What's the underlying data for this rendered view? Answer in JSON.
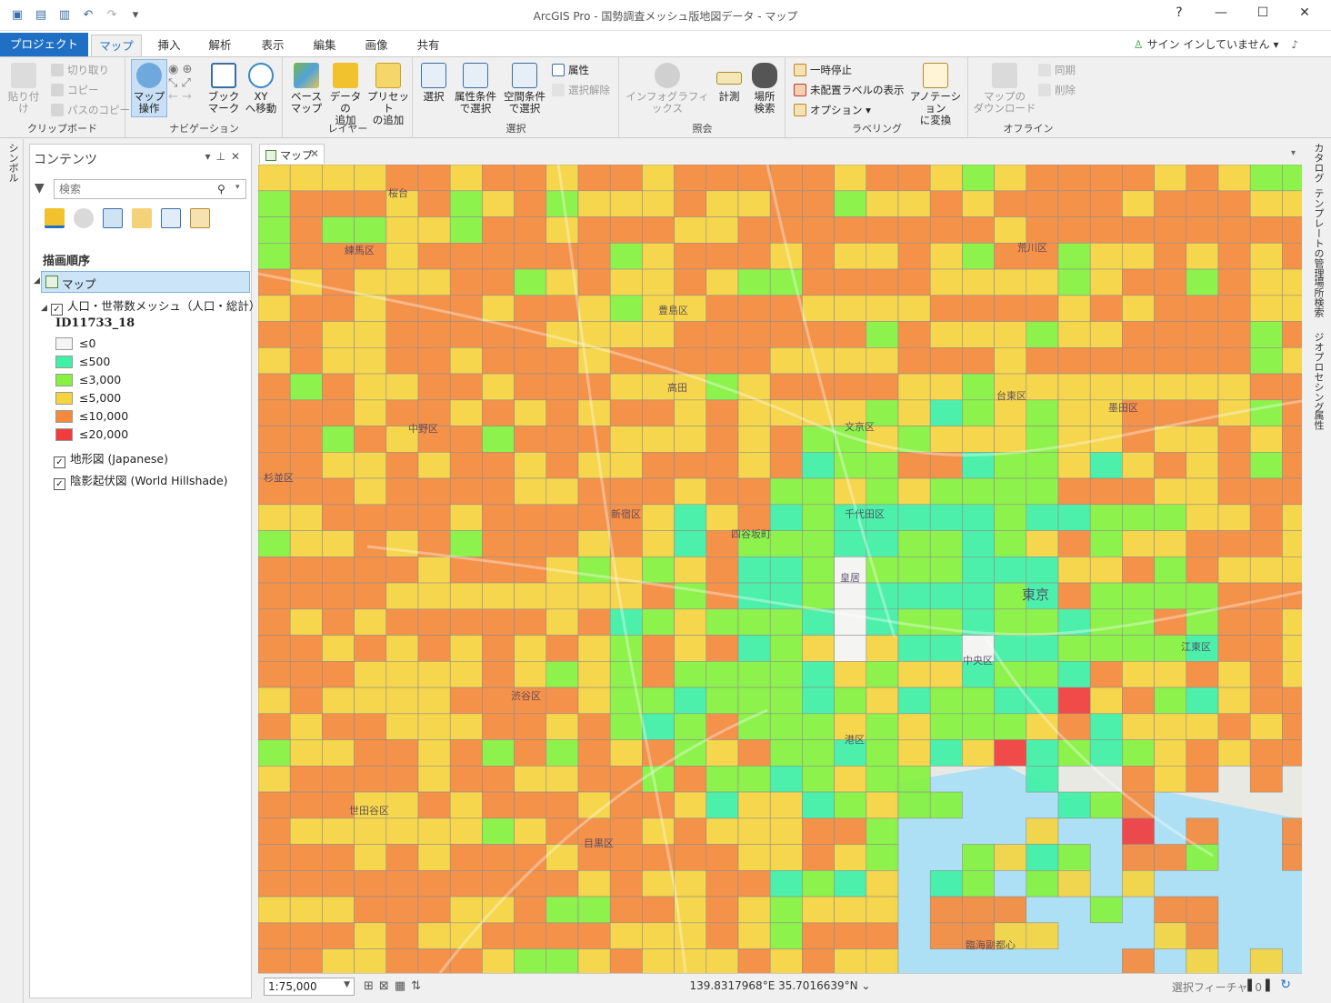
{
  "app": {
    "title": "ArcGIS Pro - 国勢調査メッシュ版地図データ - マップ",
    "help": "?",
    "minimize": "—",
    "maximize": "☐",
    "close": "✕"
  },
  "tabs": [
    {
      "label": "プロジェクト"
    },
    {
      "label": "マップ"
    },
    {
      "label": "挿入"
    },
    {
      "label": "解析"
    },
    {
      "label": "表示"
    },
    {
      "label": "編集"
    },
    {
      "label": "画像"
    },
    {
      "label": "共有"
    }
  ],
  "signin": "サイン インしていません",
  "ribbon": {
    "clipboard": {
      "label": "クリップボード",
      "paste": "貼り付け",
      "cut": "切り取り",
      "copy": "コピー",
      "copy_path": "パスのコピー"
    },
    "navigation": {
      "label": "ナビゲーション",
      "explore_1": "マップ",
      "explore_2": "操作",
      "bookmark_1": "ブック",
      "bookmark_2": "マーク",
      "xy_1": "XY",
      "xy_2": "へ移動"
    },
    "layer": {
      "label": "レイヤー",
      "basemap_1": "ベース",
      "basemap_2": "マップ",
      "adddata_1": "データの",
      "adddata_2": "追加",
      "preset_1": "プリセット",
      "preset_2": "の追加"
    },
    "selection": {
      "label": "選択",
      "select": "選択",
      "attr_1": "属性条件",
      "attr_2": "で選択",
      "loc_1": "空間条件",
      "loc_2": "で選択",
      "attributes": "属性",
      "clear": "選択解除"
    },
    "inquiry": {
      "label": "照会",
      "infographics": "インフォグラフィックス",
      "measure": "計測",
      "locate_1": "場所",
      "locate_2": "検索"
    },
    "labeling": {
      "label": "ラベリング",
      "pause": "一時停止",
      "unplaced": "未配置ラベルの表示",
      "options": "オプション",
      "convert_1": "アノテーション",
      "convert_2": "に変換"
    },
    "offline": {
      "label": "オフライン",
      "download_1": "マップの",
      "download_2": "ダウンロード",
      "sync": "同期",
      "remove": "削除"
    }
  },
  "left_strip": "シンボル",
  "contents": {
    "title": "コンテンツ",
    "search_placeholder": "検索",
    "draw_order": "描画順序",
    "map_node": "マップ",
    "layers": [
      {
        "name": "人口・世帯数メッシュ（人口・総計）"
      },
      {
        "name": "地形図 (Japanese)"
      },
      {
        "name": "陰影起伏図 (World Hillshade)"
      }
    ],
    "legend_field": "ID11733_18",
    "legend": [
      {
        "label": "≤0",
        "color": "#f4f4f4"
      },
      {
        "label": "≤500",
        "color": "#3ff0a6"
      },
      {
        "label": "≤3,000",
        "color": "#86f23f"
      },
      {
        "label": "≤5,000",
        "color": "#f5d43f"
      },
      {
        "label": "≤10,000",
        "color": "#f58a3d"
      },
      {
        "label": "≤20,000",
        "color": "#f03c3c"
      }
    ]
  },
  "map_tab": "マップ",
  "map_labels": [
    {
      "text": "練馬区"
    },
    {
      "text": "豊島区"
    },
    {
      "text": "荒川区"
    },
    {
      "text": "中野区"
    },
    {
      "text": "文京区"
    },
    {
      "text": "台東区"
    },
    {
      "text": "墨田区"
    },
    {
      "text": "杉並区"
    },
    {
      "text": "新宿区"
    },
    {
      "text": "千代田区"
    },
    {
      "text": "四谷坂町"
    },
    {
      "text": "東京"
    },
    {
      "text": "皇居"
    },
    {
      "text": "中央区"
    },
    {
      "text": "江東区"
    },
    {
      "text": "渋谷区"
    },
    {
      "text": "港区"
    },
    {
      "text": "世田谷区"
    },
    {
      "text": "目黒区"
    },
    {
      "text": "高田"
    },
    {
      "text": "桜台"
    },
    {
      "text": "臨海副都心"
    }
  ],
  "statusbar": {
    "scale": "1:75,000",
    "coords": "139.8317968°E 35.7016639°N",
    "selected": "選択フィーチャ: 0"
  },
  "right_tabs": [
    "カタログ",
    "テンプレートの管理",
    "場所検索",
    "ジオプロセシング",
    "属性"
  ]
}
